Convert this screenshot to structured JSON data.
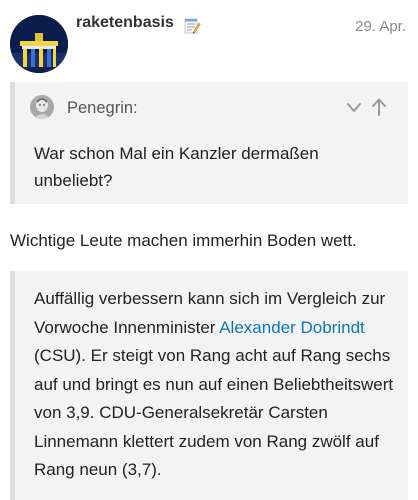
{
  "post": {
    "username": "raketenbasis",
    "badge_icon": "memo-icon",
    "date": "29. Apr.",
    "avatar_icon": "brandenburg-gate-avatar"
  },
  "quote1": {
    "author": "Penegrin:",
    "avatar_icon": "statue-avatar",
    "expand_icon": "chevron-down-icon",
    "goto_icon": "arrow-up-icon",
    "text": "War schon Mal ein Kanzler dermaßen unbeliebt?"
  },
  "reply": {
    "text": "Wichtige Leute machen immerhin Boden wett."
  },
  "quote2": {
    "text_before": "Auffällig verbessern kann sich im Vergleich zur Vorwoche Innenminister ",
    "link": "Alexander Dobrindt",
    "text_after": " (CSU). Er steigt von Rang acht auf Rang sechs auf und bringt es nun auf einen Beliebtheitswert von 3,9. CDU-Generalsekretär Carsten Linnemann klettert zudem von Rang zwölf auf Rang neun (3,7)."
  },
  "colors": {
    "link": "#0c78b8",
    "quote_background": "#f3f3f3",
    "quote_border": "#dddddd",
    "date": "#8c8c8c"
  }
}
